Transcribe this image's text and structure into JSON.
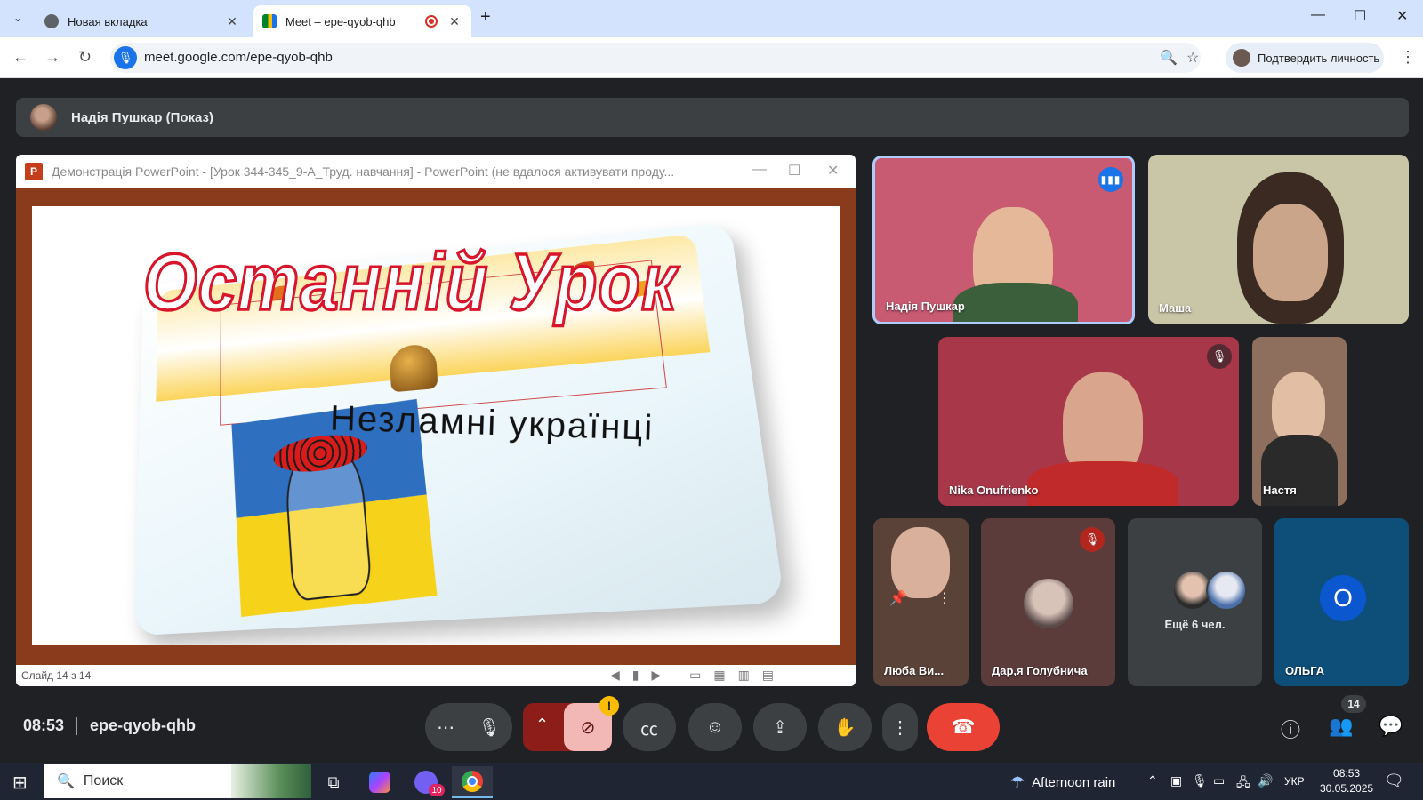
{
  "browser": {
    "tabs": [
      {
        "title": "Новая вкладка",
        "active": false
      },
      {
        "title": "Meet – epe-qyob-qhb",
        "active": true,
        "recording": true
      }
    ],
    "new_tab_icon": "plus-icon",
    "url": "meet.google.com/epe-qyob-qhb",
    "verify_identity_label": "Подтвердить личность"
  },
  "meet": {
    "presenter_bar": "Надія Пушкар (Показ)",
    "presentation": {
      "window_title": "Демонстрація PowerPoint - [Урок 344-345_9-А_Труд. навчання] - PowerPoint (не вдалося активувати проду...",
      "slide_title": "Останній Урок",
      "slide_subtitle": "Незламні українці",
      "status_text": "Слайд 14 з 14",
      "app_icon_letter": "P"
    },
    "participants": [
      {
        "name": "Надія Пушкар",
        "speaking": true
      },
      {
        "name": "Маша"
      },
      {
        "name": "Nika Onufrienko",
        "muted": true
      },
      {
        "name": "Настя"
      },
      {
        "name": "Люба Ви..."
      },
      {
        "name": "Дар,я Голубнича",
        "muted": true
      },
      {
        "name": "ОЛЬГА",
        "avatar_letter": "О"
      }
    ],
    "more_people_label": "Ещё 6 чел.",
    "time": "08:53",
    "meeting_code": "epe-qyob-qhb",
    "people_count": "14",
    "warning_badge": "!"
  },
  "taskbar": {
    "search_label": "Поиск",
    "viber_badge": "10",
    "weather": "Afternoon rain",
    "language": "УКР",
    "clock_time": "08:53",
    "clock_date": "30.05.2025"
  },
  "colors": {
    "meet_bg": "#202124",
    "tile_bg": "#3c4043",
    "end_call": "#ea4335",
    "speaking_blue": "#1a73e8",
    "slide_frame": "#8a3b1b",
    "headline_red": "#d8152b"
  }
}
